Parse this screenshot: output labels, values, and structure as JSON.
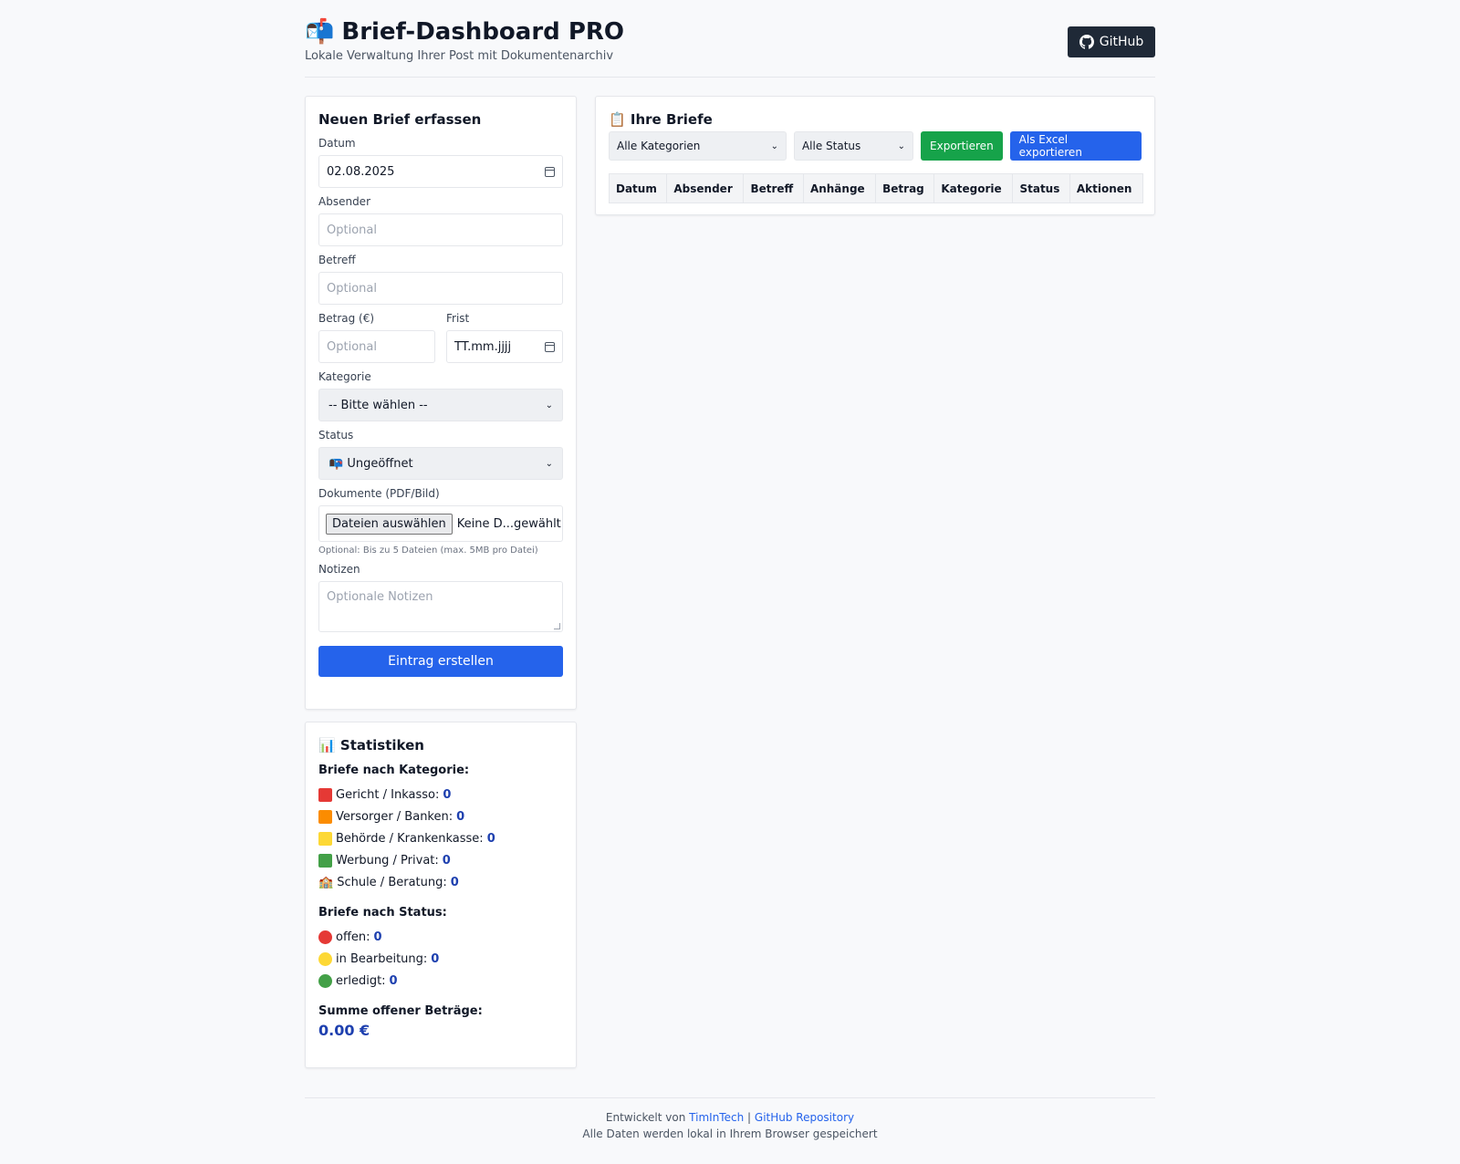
{
  "header": {
    "icon": "📬",
    "title": "Brief-Dashboard PRO",
    "subtitle": "Lokale Verwaltung Ihrer Post mit Dokumentenarchiv",
    "github_label": "GitHub"
  },
  "form": {
    "title": "Neuen Brief erfassen",
    "datum_label": "Datum",
    "datum_value": "02.08.2025",
    "absender_label": "Absender",
    "absender_placeholder": "Optional",
    "betreff_label": "Betreff",
    "betreff_placeholder": "Optional",
    "betrag_label": "Betrag (€)",
    "betrag_placeholder": "Optional",
    "frist_label": "Frist",
    "frist_value": "TT.mm.jjjj",
    "kategorie_label": "Kategorie",
    "kategorie_value": "-- Bitte wählen --",
    "status_label": "Status",
    "status_value": "📭 Ungeöffnet",
    "dokumente_label": "Dokumente (PDF/Bild)",
    "file_button": "Dateien auswählen",
    "file_text": "Keine D...gewählt",
    "file_hint": "Optional: Bis zu 5 Dateien (max. 5MB pro Datei)",
    "notizen_label": "Notizen",
    "notizen_placeholder": "Optionale Notizen",
    "submit_label": "Eintrag erstellen"
  },
  "stats": {
    "title": "📊 Statistiken",
    "by_category_title": "Briefe nach Kategorie:",
    "categories": [
      {
        "label": "Gericht / Inkasso:",
        "value": "0",
        "color": "#e53935"
      },
      {
        "label": "Versorger / Banken:",
        "value": "0",
        "color": "#fb8c00"
      },
      {
        "label": "Behörde / Krankenkasse:",
        "value": "0",
        "color": "#fdd835"
      },
      {
        "label": "Werbung / Privat:",
        "value": "0",
        "color": "#43a047"
      },
      {
        "label": "Schule / Beratung:",
        "value": "0",
        "icon": "🏫"
      }
    ],
    "by_status_title": "Briefe nach Status:",
    "statuses": [
      {
        "label": "offen:",
        "value": "0",
        "color": "#e53935"
      },
      {
        "label": "in Bearbeitung:",
        "value": "0",
        "color": "#fdd835"
      },
      {
        "label": "erledigt:",
        "value": "0",
        "color": "#43a047"
      }
    ],
    "sum_title": "Summe offener Beträge:",
    "sum_value": "0.00 €"
  },
  "list": {
    "title": "📋 Ihre Briefe",
    "filter_category": "Alle Kategorien",
    "filter_status": "Alle Status",
    "export_label": "Exportieren",
    "excel_label": "Als Excel exportieren",
    "columns": [
      "Datum",
      "Absender",
      "Betreff",
      "Anhänge",
      "Betrag",
      "Kategorie",
      "Status",
      "Aktionen"
    ]
  },
  "footer": {
    "developed_by": "Entwickelt von",
    "author": "TimInTech",
    "separator": "|",
    "repo_link": "GitHub Repository",
    "storage_note": "Alle Daten werden lokal in Ihrem Browser gespeichert"
  }
}
